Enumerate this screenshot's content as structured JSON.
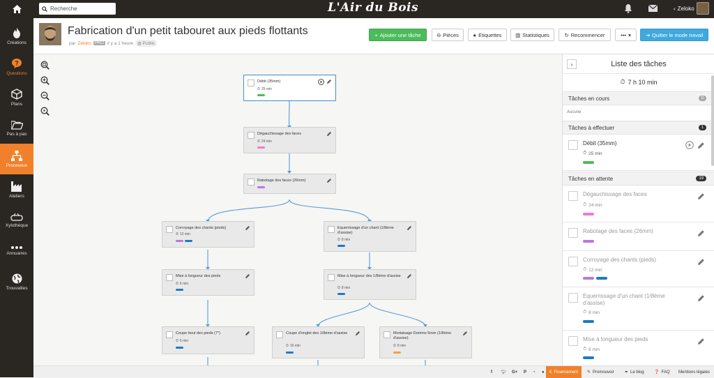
{
  "topbar": {
    "search_placeholder": "Recherche",
    "logo": "L'Air du Bois",
    "user": "Zeloko"
  },
  "sidebar": {
    "items": [
      {
        "label": "Créations",
        "icon": "flame-icon"
      },
      {
        "label": "Questions",
        "icon": "question-icon"
      },
      {
        "label": "Plans",
        "icon": "box-icon"
      },
      {
        "label": "Pas à pas",
        "icon": "folder-icon"
      },
      {
        "label": "Processus",
        "icon": "process-icon"
      },
      {
        "label": "Ateliers",
        "icon": "factory-icon"
      },
      {
        "label": "Xylothèque",
        "icon": "log-icon"
      },
      {
        "label": "Annuaires",
        "icon": "dots-icon"
      },
      {
        "label": "Trouvailles",
        "icon": "globe-icon"
      }
    ]
  },
  "header": {
    "title": "Fabrication d'un petit tabouret aux pieds flottants",
    "by": "par",
    "author": "Zeloko",
    "pro": "PRO",
    "time": "il y a 1 heure",
    "visibility": "Public",
    "buttons": {
      "add_task": "Ajouter une tâche",
      "parts": "Pièces",
      "tags": "Etiquettes",
      "stats": "Statistiques",
      "restart": "Recommencer",
      "more": "•••",
      "quit": "Quitter le mode travail"
    }
  },
  "tag_colors": {
    "green": "#4cbb5b",
    "pink": "#f07ad0",
    "purple": "#b978e0",
    "blue": "#1f7ac0",
    "orange": "#f0a14a"
  },
  "nodes": [
    {
      "name": "Débit (35mm)",
      "time": "25 min"
    },
    {
      "name": "Dégauchissage des faces",
      "time": "24 min"
    },
    {
      "name": "Rabotage des faces (26mm)",
      "time": ""
    },
    {
      "name": "Corroyage des chants (pieds)",
      "time": "12 min"
    },
    {
      "name": "Equerrissage d'un chant (1/8ème d'assise)",
      "time": "8 min"
    },
    {
      "name": "Mise à longueur des pieds",
      "time": "6 min"
    },
    {
      "name": "Mise à longueur des 1/8ème d'assise",
      "time": "8 min"
    },
    {
      "name": "Coupe bout des pieds (7°)",
      "time": "6 min"
    },
    {
      "name": "Coupe d'onglet des 1/8ème d'assise",
      "time": "16 min"
    },
    {
      "name": "Mortaisage Domino 5mm (1/8ème d'assise)",
      "time": "8 min"
    }
  ],
  "panel": {
    "title": "Liste des tâches",
    "total": "7 h 10 min",
    "in_progress": {
      "label": "Tâches en cours",
      "count": "0",
      "empty": "Aucune"
    },
    "todo": {
      "label": "Tâches à effectuer",
      "count": "1"
    },
    "waiting": {
      "label": "Tâches en attente",
      "count": "19"
    },
    "todo_tasks": [
      {
        "name": "Débit (35mm)",
        "time": "25 min"
      }
    ],
    "waiting_tasks": [
      {
        "name": "Dégauchissage des faces",
        "time": "24 min"
      },
      {
        "name": "Rabotage des faces (26mm)",
        "time": ""
      },
      {
        "name": "Corroyage des chants (pieds)",
        "time": "12 min"
      },
      {
        "name": "Equerrissage d'un chant (1/8ème d'assise)",
        "time": "8 min"
      },
      {
        "name": "Mise à longueur des pieds",
        "time": "6 min"
      }
    ]
  },
  "footer": {
    "financement": "Financement",
    "promouvoir": "Promouvoir",
    "blog": "Le blog",
    "faq": "FAQ",
    "legal": "Mentions légales"
  }
}
